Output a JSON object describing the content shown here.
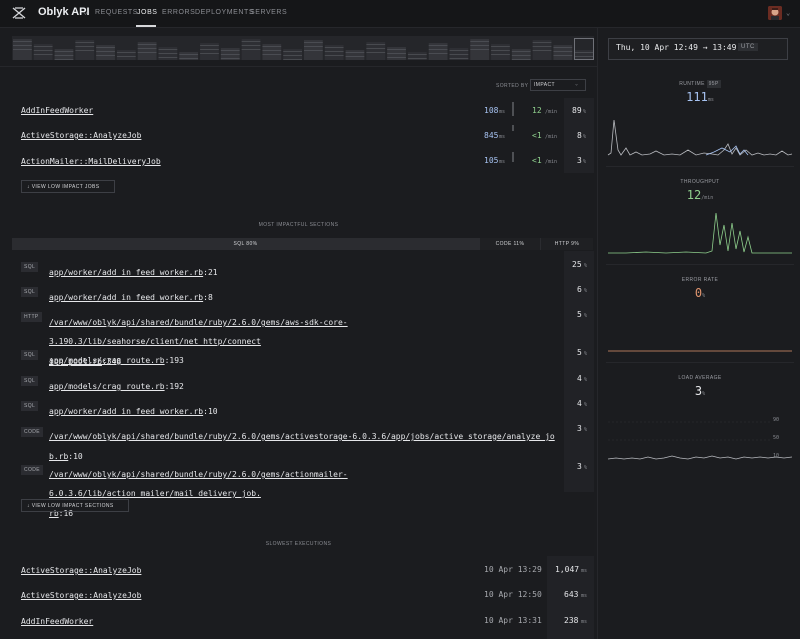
{
  "app": {
    "name": "Oblyk API"
  },
  "nav": {
    "tabs": [
      {
        "label": "REQUESTS"
      },
      {
        "label": "JOBS"
      },
      {
        "label": "ERRORS"
      },
      {
        "label": "DEPLOYMENTS"
      },
      {
        "label": "SERVERS"
      }
    ],
    "active": "JOBS"
  },
  "date_range": {
    "text": "Thu, 10 Apr 12:49 → 13:49",
    "tz": "UTC"
  },
  "jobs": {
    "sorted_by_label": "SORTED BY",
    "sort_value": "IMPACT",
    "rows": [
      {
        "name": "AddInFeedWorker",
        "duration": "108",
        "duration_unit": "ms",
        "throughput": "12",
        "throughput_unit": "/min",
        "impact": "89",
        "impact_unit": "%"
      },
      {
        "name": "ActiveStorage::AnalyzeJob",
        "duration": "845",
        "duration_unit": "ms",
        "throughput": "<1",
        "throughput_unit": "/min",
        "impact": "8",
        "impact_unit": "%"
      },
      {
        "name": "ActionMailer::MailDeliveryJob",
        "duration": "105",
        "duration_unit": "ms",
        "throughput": "<1",
        "throughput_unit": "/min",
        "impact": "3",
        "impact_unit": "%"
      }
    ],
    "view_low_label": "↓ VIEW LOW IMPACT JOBS"
  },
  "sections": {
    "title": "MOST IMPACTFUL SECTIONS",
    "split": [
      {
        "label": "SQL",
        "value": "80",
        "unit": "%",
        "fraction": 0.8
      },
      {
        "label": "CODE",
        "value": "11",
        "unit": "%",
        "fraction": 0.11
      },
      {
        "label": "HTTP",
        "value": "9",
        "unit": "%",
        "fraction": 0.09
      }
    ],
    "rows": [
      {
        "tag": "SQL",
        "path": "app/worker/add_in_feed_worker.rb",
        "path2": "",
        "line": ":21",
        "pct": "25",
        "unit": "%"
      },
      {
        "tag": "SQL",
        "path": "app/worker/add_in_feed_worker.rb",
        "path2": "",
        "line": ":8",
        "pct": "6",
        "unit": "%"
      },
      {
        "tag": "HTTP",
        "path": "/var/www/oblyk/api/shared/bundle/ruby/2.6.0/gems/aws-sdk-core-3.190.3/lib/seahorse/client/net_http/connect",
        "path2": "ion_pool.rb",
        "line": ":348",
        "pct": "5",
        "unit": "%"
      },
      {
        "tag": "SQL",
        "path": "app/models/crag_route.rb",
        "path2": "",
        "line": ":193",
        "pct": "5",
        "unit": "%"
      },
      {
        "tag": "SQL",
        "path": "app/models/crag_route.rb",
        "path2": "",
        "line": ":192",
        "pct": "4",
        "unit": "%"
      },
      {
        "tag": "SQL",
        "path": "app/worker/add_in_feed_worker.rb",
        "path2": "",
        "line": ":10",
        "pct": "4",
        "unit": "%"
      },
      {
        "tag": "CODE",
        "path": "/var/www/oblyk/api/shared/bundle/ruby/2.6.0/gems/activestorage-6.0.3.6/app/jobs/active_storage/analyze_jo",
        "path2": "b.rb",
        "line": ":10",
        "pct": "3",
        "unit": "%"
      },
      {
        "tag": "CODE",
        "path": "/var/www/oblyk/api/shared/bundle/ruby/2.6.0/gems/actionmailer-6.0.3.6/lib/action_mailer/mail_delivery_job.",
        "path2": "rb",
        "line": ":16",
        "pct": "3",
        "unit": "%"
      }
    ],
    "view_low_label": "↓ VIEW LOW IMPACT SECTIONS"
  },
  "slowest": {
    "title": "SLOWEST EXECUTIONS",
    "rows": [
      {
        "name": "ActiveStorage::AnalyzeJob",
        "date": "10 Apr 13:29",
        "duration": "1,047",
        "unit": "ms"
      },
      {
        "name": "ActiveStorage::AnalyzeJob",
        "date": "10 Apr 12:50",
        "duration": "643",
        "unit": "ms"
      },
      {
        "name": "AddInFeedWorker",
        "date": "10 Apr 13:31",
        "duration": "238",
        "unit": "ms"
      }
    ]
  },
  "metrics": {
    "runtime": {
      "title": "RUNTIME",
      "badge": "95P",
      "value": "111",
      "unit": "ms"
    },
    "throughput": {
      "title": "THROUGHPUT",
      "value": "12",
      "unit": "/min"
    },
    "error_rate": {
      "title": "ERROR RATE",
      "value": "0",
      "unit": "%"
    },
    "load_average": {
      "title": "LOAD AVERAGE",
      "value": "3",
      "unit": "%",
      "ticks": [
        "90",
        "50",
        "10"
      ]
    }
  },
  "colors": {
    "accent_blue": "#a7c3f2",
    "accent_green": "#8fd08d",
    "error_orange": "#e0956f",
    "line_grey": "#b9bbc0"
  }
}
